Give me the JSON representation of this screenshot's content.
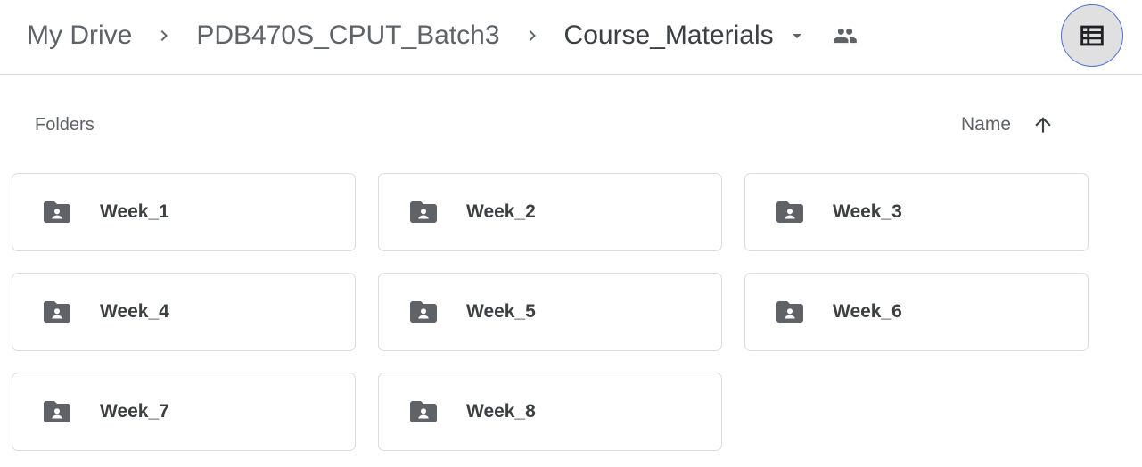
{
  "breadcrumb": {
    "items": [
      {
        "label": "My Drive"
      },
      {
        "label": "PDB470S_CPUT_Batch3"
      },
      {
        "label": "Course_Materials"
      }
    ],
    "dropdown_icon": "arrow-drop-down-icon",
    "shared_icon": "shared-people-icon"
  },
  "view_toggle": {
    "icon": "list-view-icon"
  },
  "folders_section": {
    "title": "Folders",
    "sort_label": "Name",
    "sort_direction_icon": "arrow-upward-icon",
    "items": [
      {
        "name": "Week_1",
        "icon": "shared-folder-icon"
      },
      {
        "name": "Week_2",
        "icon": "shared-folder-icon"
      },
      {
        "name": "Week_3",
        "icon": "shared-folder-icon"
      },
      {
        "name": "Week_4",
        "icon": "shared-folder-icon"
      },
      {
        "name": "Week_5",
        "icon": "shared-folder-icon"
      },
      {
        "name": "Week_6",
        "icon": "shared-folder-icon"
      },
      {
        "name": "Week_7",
        "icon": "shared-folder-icon"
      },
      {
        "name": "Week_8",
        "icon": "shared-folder-icon"
      }
    ]
  },
  "colors": {
    "text_primary": "#3c4043",
    "text_secondary": "#5f6368",
    "border": "#dadce0",
    "toggle_bg": "#e0e0e0",
    "toggle_ring": "#4f6fd8"
  }
}
